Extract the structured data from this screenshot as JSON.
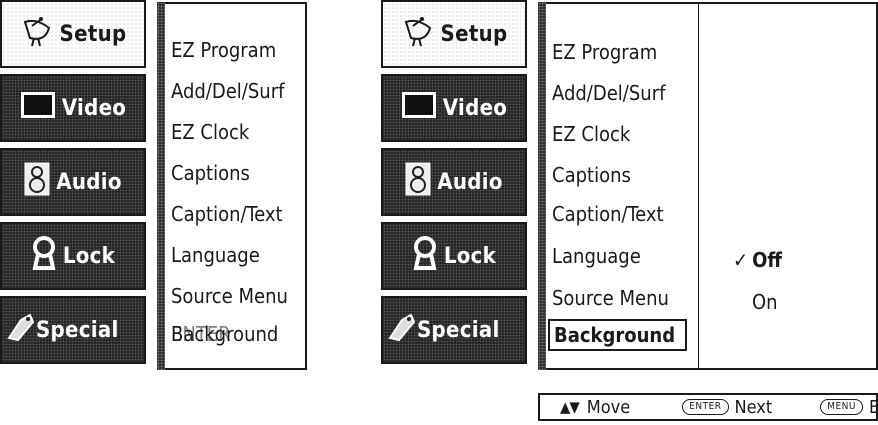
{
  "left_panel": {
    "tabs": [
      {
        "label": "Setup",
        "icon": "satellite-dish-icon"
      },
      {
        "label": "Video",
        "icon": "tv-screen-icon"
      },
      {
        "label": "Audio",
        "icon": "speaker-icon"
      },
      {
        "label": "Lock",
        "icon": "keyhole-icon"
      },
      {
        "label": "Special",
        "icon": "tag-icon"
      }
    ],
    "menu_items": [
      "EZ Program",
      "Add/Del/Surf",
      "EZ Clock",
      "Captions",
      "Caption/Text",
      "Language",
      "Source Menu"
    ],
    "overlap_text_a": "Background",
    "overlap_text_b": "ENTER"
  },
  "right_panel": {
    "tabs": [
      {
        "label": "Setup",
        "icon": "satellite-dish-icon"
      },
      {
        "label": "Video",
        "icon": "tv-screen-icon"
      },
      {
        "label": "Audio",
        "icon": "speaker-icon"
      },
      {
        "label": "Lock",
        "icon": "keyhole-icon"
      },
      {
        "label": "Special",
        "icon": "tag-icon"
      }
    ],
    "menu_items": [
      "EZ Program",
      "Add/Del/Surf",
      "EZ Clock",
      "Captions",
      "Caption/Text",
      "Language",
      "Source Menu"
    ],
    "selected_item": "Background",
    "options": [
      {
        "label": "Off",
        "checked": true,
        "check_mark": "✓"
      },
      {
        "label": "On",
        "checked": false,
        "check_mark": ""
      }
    ]
  },
  "footer": {
    "move_arrows": "▲▼",
    "move_label": "Move",
    "enter_key": "ENTER",
    "next_label": "Next",
    "menu_key": "MENU",
    "back_label": "Back"
  }
}
